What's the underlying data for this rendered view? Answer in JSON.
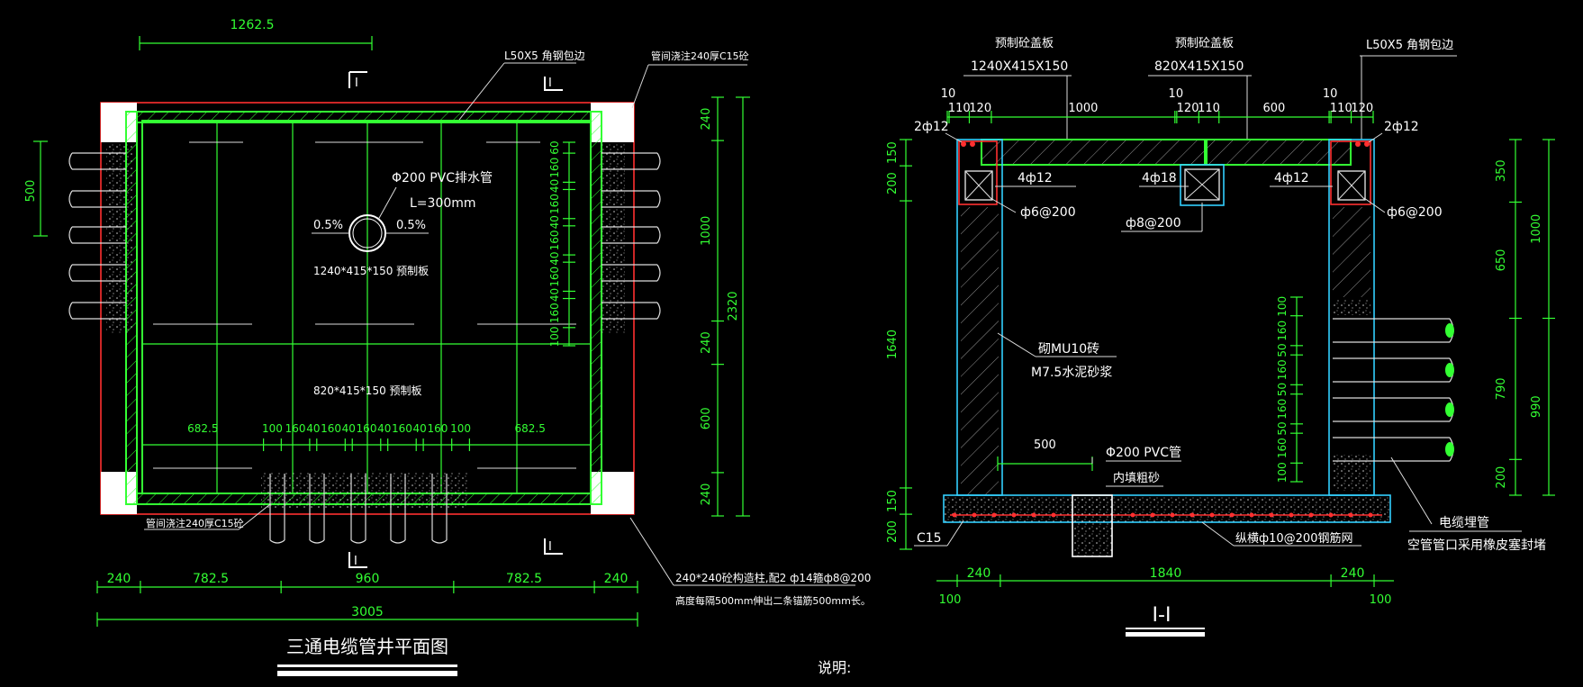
{
  "colors": {
    "background": "#000000",
    "dimension": "#33ff33",
    "label": "#ffffff",
    "outline": "#ff3030",
    "column": "#33d0ff"
  },
  "plan": {
    "title": "三通电缆管井平面图",
    "dim_top": "1262.5",
    "dim_left": "500",
    "steel_edge_label": "L50X5 角钢包边",
    "pipe_fill_label_top": "管间浇注240厚C15砼",
    "pipe_fill_label_bottom": "管间浇注240厚C15砼",
    "section_mark": "I",
    "pvc_label": "Φ200 PVC排水管",
    "pvc_length": "L=300mm",
    "slope_left": "0.5%",
    "slope_right": "0.5%",
    "slab_large": "1240*415*150 预制板",
    "slab_small": "820*415*150 预制板",
    "pipe_dims_vertical": [
      "60",
      "160",
      "40",
      "160",
      "40",
      "160",
      "40",
      "160",
      "40",
      "160",
      "100"
    ],
    "pipe_dims_bottom": [
      "682.5",
      "100",
      "160",
      "40",
      "160",
      "40",
      "160",
      "40",
      "160",
      "40",
      "160",
      "100",
      "682.5"
    ],
    "bottom_dims": [
      "240",
      "782.5",
      "960",
      "782.5",
      "240"
    ],
    "total_width": "3005",
    "right_dims": [
      "240",
      "1000",
      "240",
      "600",
      "240"
    ],
    "total_height": "2320",
    "column_note_1": "240*240砼构造柱,配2 ф14箍ф8@200",
    "column_note_2": "高度每隔500mm伸出二条锚筋500mm长。"
  },
  "section": {
    "title": "I-I",
    "slab_label_1": "预制砼盖板",
    "slab_size_1": "1240X415X150",
    "slab_label_2": "预制砼盖板",
    "slab_size_2": "820X415X150",
    "steel_edge_label": "L50X5 角钢包边",
    "top_dims": [
      "10",
      "110",
      "120",
      "1000",
      "10",
      "120",
      "110",
      "600",
      "10",
      "110",
      "120"
    ],
    "rebar_left": "2ф12",
    "rebar_right": "2ф12",
    "beam_left": "4ф12",
    "beam_mid": "4ф18",
    "beam_right": "4ф12",
    "stirrup_left": "ф6@200",
    "stirrup_mid": "ф8@200",
    "stirrup_right": "ф6@200",
    "left_dims": [
      "150",
      "200",
      "1640",
      "150",
      "200"
    ],
    "brick_label_1": "砌MU10砖",
    "brick_label_2": "M7.5水泥砂浆",
    "pipe_side_dims": [
      "100",
      "160",
      "50",
      "160",
      "50",
      "160",
      "50",
      "160",
      "100"
    ],
    "pvc_offset": "500",
    "pvc_label": "Φ200 PVC管",
    "sand_label": "内填粗砂",
    "concrete_label": "C15",
    "mesh_label": "纵横ф10@200钢筋网",
    "right_dims_inner": [
      "350",
      "650",
      "790",
      "200"
    ],
    "right_dims_outer": [
      "1000",
      "990"
    ],
    "cable_label": "电缆埋管",
    "seal_label": "空管管口采用橡皮塞封堵",
    "bottom_dims": [
      "240",
      "1840",
      "240"
    ],
    "bottom_edge_left": "100",
    "bottom_edge_right": "100"
  },
  "notes": {
    "heading": "说明:"
  }
}
